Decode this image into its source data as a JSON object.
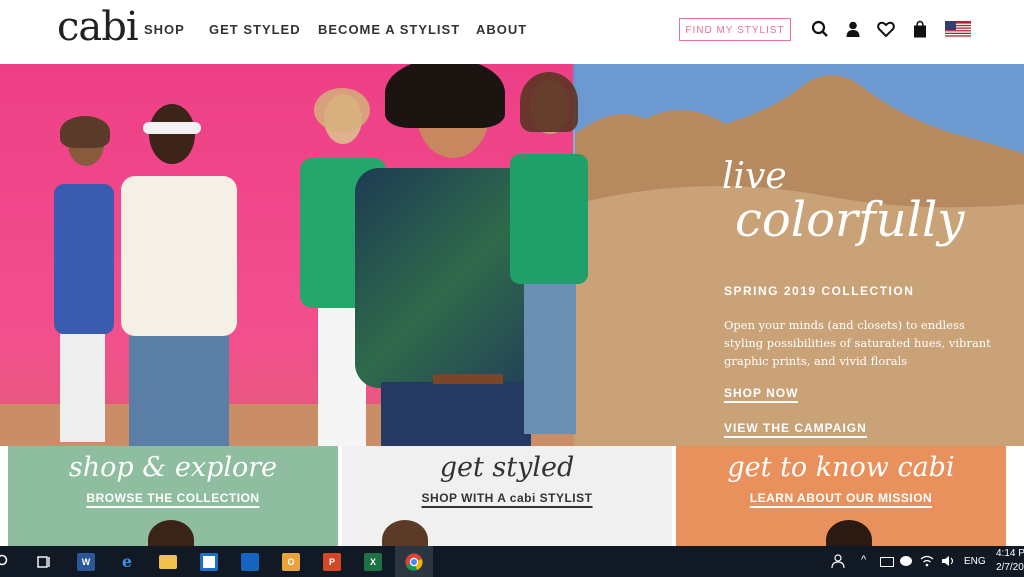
{
  "header": {
    "logo": "cabi",
    "nav": [
      "SHOP",
      "GET STYLED",
      "BECOME A STYLIST",
      "ABOUT"
    ],
    "find_stylist_label": "FIND MY STYLIST",
    "icons": [
      "search-icon",
      "account-icon",
      "wishlist-heart-icon",
      "shopping-bag-icon",
      "us-flag-icon"
    ]
  },
  "hero": {
    "script_line1": "live",
    "script_line2": "colorfully",
    "subtitle": "SPRING 2019 COLLECTION",
    "description": "Open your minds (and closets) to endless styling possibilities of saturated hues, vibrant graphic prints, and vivid florals",
    "shop_now_label": "SHOP NOW",
    "campaign_label": "VIEW THE CAMPAIGN"
  },
  "promos": [
    {
      "title": "shop & explore",
      "link": "BROWSE THE COLLECTION",
      "bg": "#8fbd9f",
      "color": "#ffffff"
    },
    {
      "title": "get styled",
      "link": "SHOP WITH A cabi STYLIST",
      "bg": "#f0f0f0",
      "color": "#333333"
    },
    {
      "title": "get to know cabi",
      "link": "LEARN ABOUT OUR MISSION",
      "bg": "#e9915d",
      "color": "#ffffff"
    }
  ],
  "taskbar": {
    "apps": [
      {
        "name": "task-view-icon",
        "label": ""
      },
      {
        "name": "word-icon",
        "label": "W"
      },
      {
        "name": "edge-icon",
        "label": "e"
      },
      {
        "name": "file-explorer-icon",
        "label": ""
      },
      {
        "name": "store-icon",
        "label": ""
      },
      {
        "name": "defender-icon",
        "label": ""
      },
      {
        "name": "outlook-icon",
        "label": "O"
      },
      {
        "name": "powerpoint-icon",
        "label": "P"
      },
      {
        "name": "excel-icon",
        "label": "X"
      },
      {
        "name": "chrome-icon",
        "label": ""
      }
    ],
    "language": "ENG",
    "time": "4:14 P",
    "date": "2/7/20"
  },
  "colors": {
    "accent": "#e8728f",
    "taskbar": "#111a24"
  }
}
